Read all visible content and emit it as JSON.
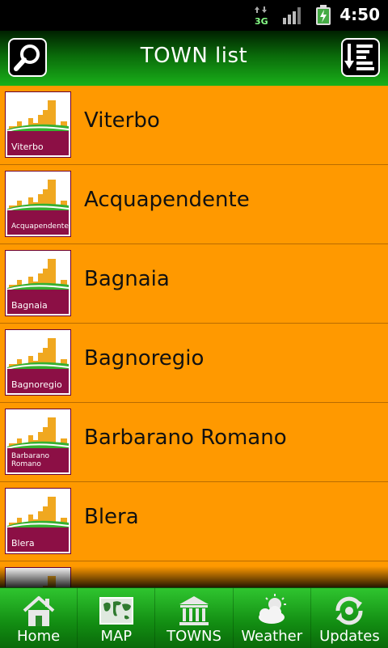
{
  "status_bar": {
    "network": "3G",
    "time": "4:50"
  },
  "header": {
    "title": "TOWN list",
    "search_icon": "search-icon",
    "sort_icon": "sort-list-icon"
  },
  "towns": [
    {
      "name": "Viterbo",
      "thumb_label": "Viterbo"
    },
    {
      "name": "Acquapendente",
      "thumb_label": "Acquapendente"
    },
    {
      "name": "Bagnaia",
      "thumb_label": "Bagnaia"
    },
    {
      "name": "Bagnoregio",
      "thumb_label": "Bagnoregio"
    },
    {
      "name": "Barbarano Romano",
      "thumb_label": "Barbarano Romano"
    },
    {
      "name": "Blera",
      "thumb_label": "Blera"
    },
    {
      "name": "",
      "thumb_label": ""
    }
  ],
  "bottom_nav": [
    {
      "label": "Home",
      "icon": "home-icon"
    },
    {
      "label": "MAP",
      "icon": "map-icon"
    },
    {
      "label": "TOWNS",
      "icon": "towns-icon"
    },
    {
      "label": "Weather",
      "icon": "weather-icon"
    },
    {
      "label": "Updates",
      "icon": "updates-icon"
    }
  ],
  "colors": {
    "list_background": "#ff9900",
    "header_green": "#19b019",
    "thumb_band": "#8c0f45",
    "nav_green": "#2fc52f"
  }
}
